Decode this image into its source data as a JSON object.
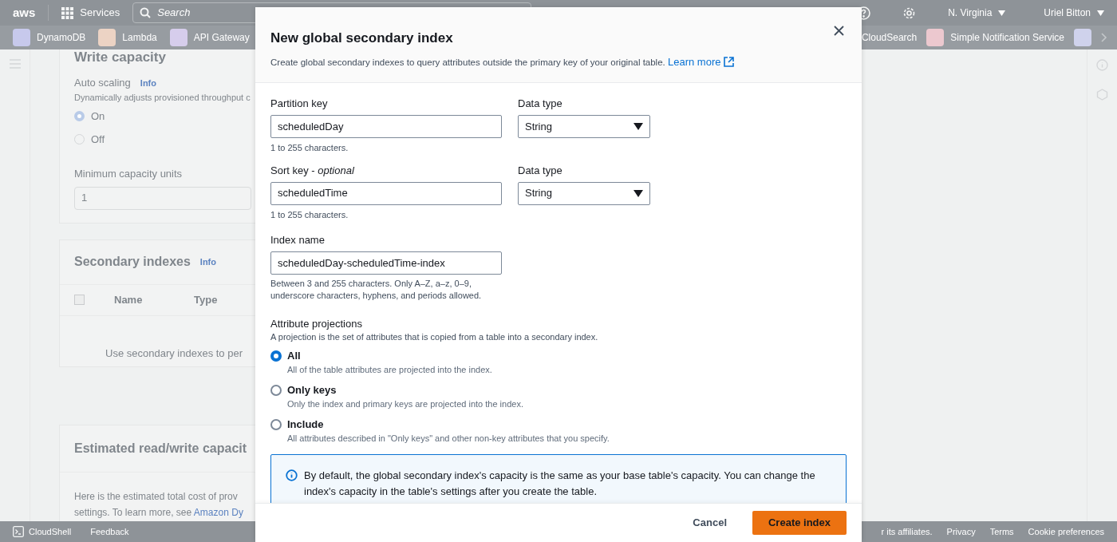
{
  "top_nav": {
    "logo": "aws",
    "services": "Services",
    "search_placeholder": "Search",
    "region": "N. Virginia",
    "user": "Uriel Bitton"
  },
  "favorites_left": [
    {
      "label": "DynamoDB",
      "color": "#c7c9ec"
    },
    {
      "label": "Lambda",
      "color": "#ecd3c4"
    },
    {
      "label": "API Gateway",
      "color": "#d6cdec"
    }
  ],
  "favorites_right": [
    {
      "label": "CloudSearch"
    },
    {
      "label": "Simple Notification Service",
      "color": "#ecc8cf"
    },
    {
      "color": "#cfd2ec"
    }
  ],
  "background_page": {
    "write_capacity": {
      "title": "Write capacity",
      "auto_scaling": "Auto scaling",
      "info": "Info",
      "description": "Dynamically adjusts provisioned throughput c",
      "options": [
        {
          "label": "On",
          "selected": true
        },
        {
          "label": "Off",
          "selected": false
        }
      ],
      "min_label": "Minimum capacity units",
      "min_value": "1"
    },
    "secondary_indexes": {
      "title": "Secondary indexes",
      "info": "Info",
      "checked": false,
      "columns": [
        "Name",
        "Type"
      ],
      "empty": "Use secondary indexes to per"
    },
    "estimate": {
      "title": "Estimated read/write capacit",
      "line_1": "Here is the estimated total cost of prov",
      "line_2": "settings. To learn more, see ",
      "link": "Amazon Dy"
    }
  },
  "footer": {
    "cloudshell": "CloudShell",
    "feedback": "Feedback",
    "copyright": "r its affiliates.",
    "links": [
      "Privacy",
      "Terms",
      "Cookie preferences"
    ]
  },
  "modal": {
    "title": "New global secondary index",
    "description": "Create global secondary indexes to query attributes outside the primary key of your original table.",
    "learn_more": "Learn more",
    "keys": [
      {
        "label": "Partition key",
        "value": "scheduledDay",
        "hint": "1 to 255 characters.",
        "type_label": "Data type",
        "type_value": "String"
      },
      {
        "label": "Sort key - *optional*",
        "value": "scheduledTime",
        "hint": "1 to 255 characters.",
        "type_label": "Data type",
        "type_value": "String"
      }
    ],
    "index_name": {
      "label": "Index name",
      "value": "scheduledDay-scheduledTime-index",
      "hint": "Between 3 and 255 characters. Only A–Z, a–z, 0–9, underscore characters, hyphens, and periods allowed."
    },
    "projections": {
      "label": "Attribute projections",
      "description": "A projection is the set of attributes that is copied from a table into a secondary index.",
      "options": [
        {
          "label": "All",
          "description": "All of the table attributes are projected into the index.",
          "selected": true
        },
        {
          "label": "Only keys",
          "description": "Only the index and primary keys are projected into the index.",
          "selected": false
        },
        {
          "label": "Include",
          "description": "All attributes described in \"Only keys\" and other non-key attributes that you specify.",
          "selected": false
        }
      ]
    },
    "alert": "By default, the global secondary index's capacity is the same as your base table's capacity. You can change the index's capacity in the table's settings after you create the table.",
    "cancel": "Cancel",
    "create": "Create index"
  }
}
